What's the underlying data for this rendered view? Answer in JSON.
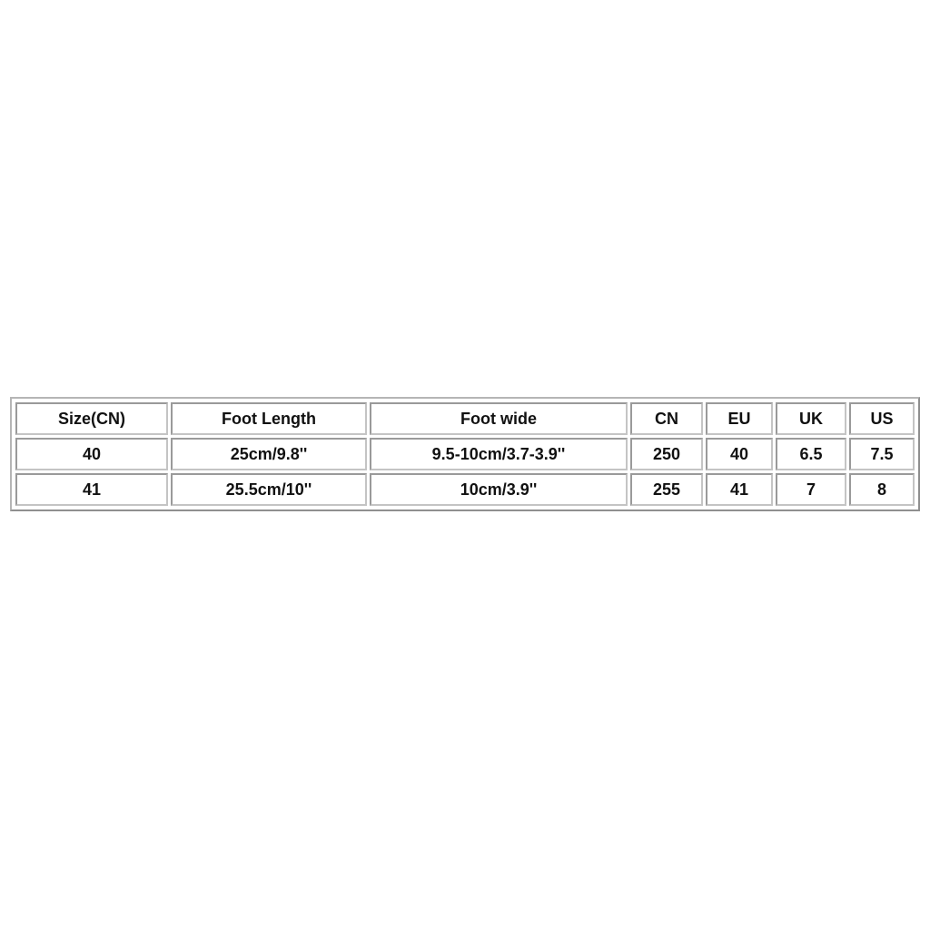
{
  "size_table": {
    "headers": [
      "Size(CN)",
      "Foot Length",
      "Foot wide",
      "CN",
      "EU",
      "UK",
      "US"
    ],
    "rows": [
      [
        "40",
        "25cm/9.8''",
        "9.5-10cm/3.7-3.9''",
        "250",
        "40",
        "6.5",
        "7.5"
      ],
      [
        "41",
        "25.5cm/10''",
        "10cm/3.9''",
        "255",
        "41",
        "7",
        "8"
      ]
    ]
  }
}
